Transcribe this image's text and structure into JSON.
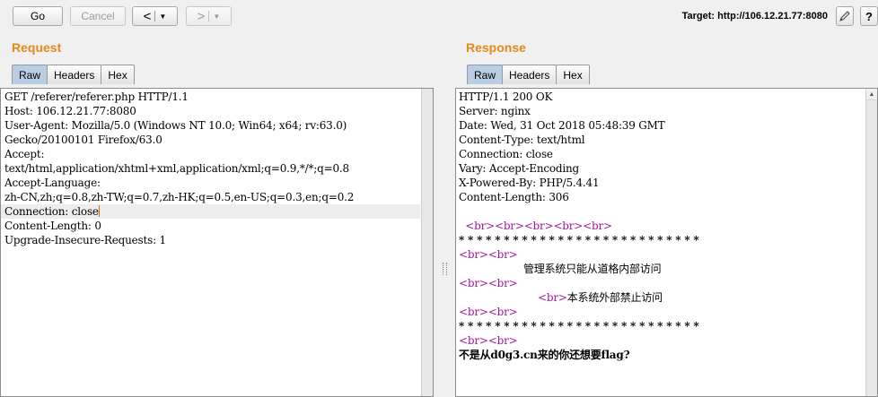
{
  "toolbar": {
    "go_label": "Go",
    "cancel_label": "Cancel",
    "back_arrow": "<",
    "forward_arrow": ">",
    "dropdown_glyph": "▼",
    "target_label": "Target: http://106.12.21.77:8080"
  },
  "request": {
    "title": "Request",
    "tabs": [
      "Raw",
      "Headers",
      "Hex"
    ],
    "active_tab": "Raw",
    "lines": [
      "GET /referer/referer.php HTTP/1.1",
      "Host: 106.12.21.77:8080",
      "User-Agent: Mozilla/5.0 (Windows NT 10.0; Win64; x64; rv:63.0)",
      "Gecko/20100101 Firefox/63.0",
      "Accept:",
      "text/html,application/xhtml+xml,application/xml;q=0.9,*/*;q=0.8",
      "Accept-Language:",
      "zh-CN,zh;q=0.8,zh-TW;q=0.7,zh-HK;q=0.5,en-US;q=0.3,en;q=0.2",
      "Connection: close",
      "Content-Length: 0",
      "Upgrade-Insecure-Requests: 1"
    ]
  },
  "response": {
    "title": "Response",
    "tabs": [
      "Raw",
      "Headers",
      "Hex"
    ],
    "active_tab": "Raw",
    "headers": [
      "HTTP/1.1 200 OK",
      "Server: nginx",
      "Date: Wed, 31 Oct 2018 05:48:39 GMT",
      "Content-Type: text/html",
      "Connection: close",
      "Vary: Accept-Encoding",
      "X-Powered-By: PHP/5.4.41",
      "Content-Length: 306"
    ],
    "body": {
      "br_tag": "<br>",
      "stars": "* * * * * * * * * * * * * * * * * * * * * * * * * * *",
      "message1": "管理系统只能从道格内部访问",
      "message2": "本系统外部禁止访问",
      "flag_line": "不是从d0g3.cn来的你还想要flag?"
    }
  }
}
